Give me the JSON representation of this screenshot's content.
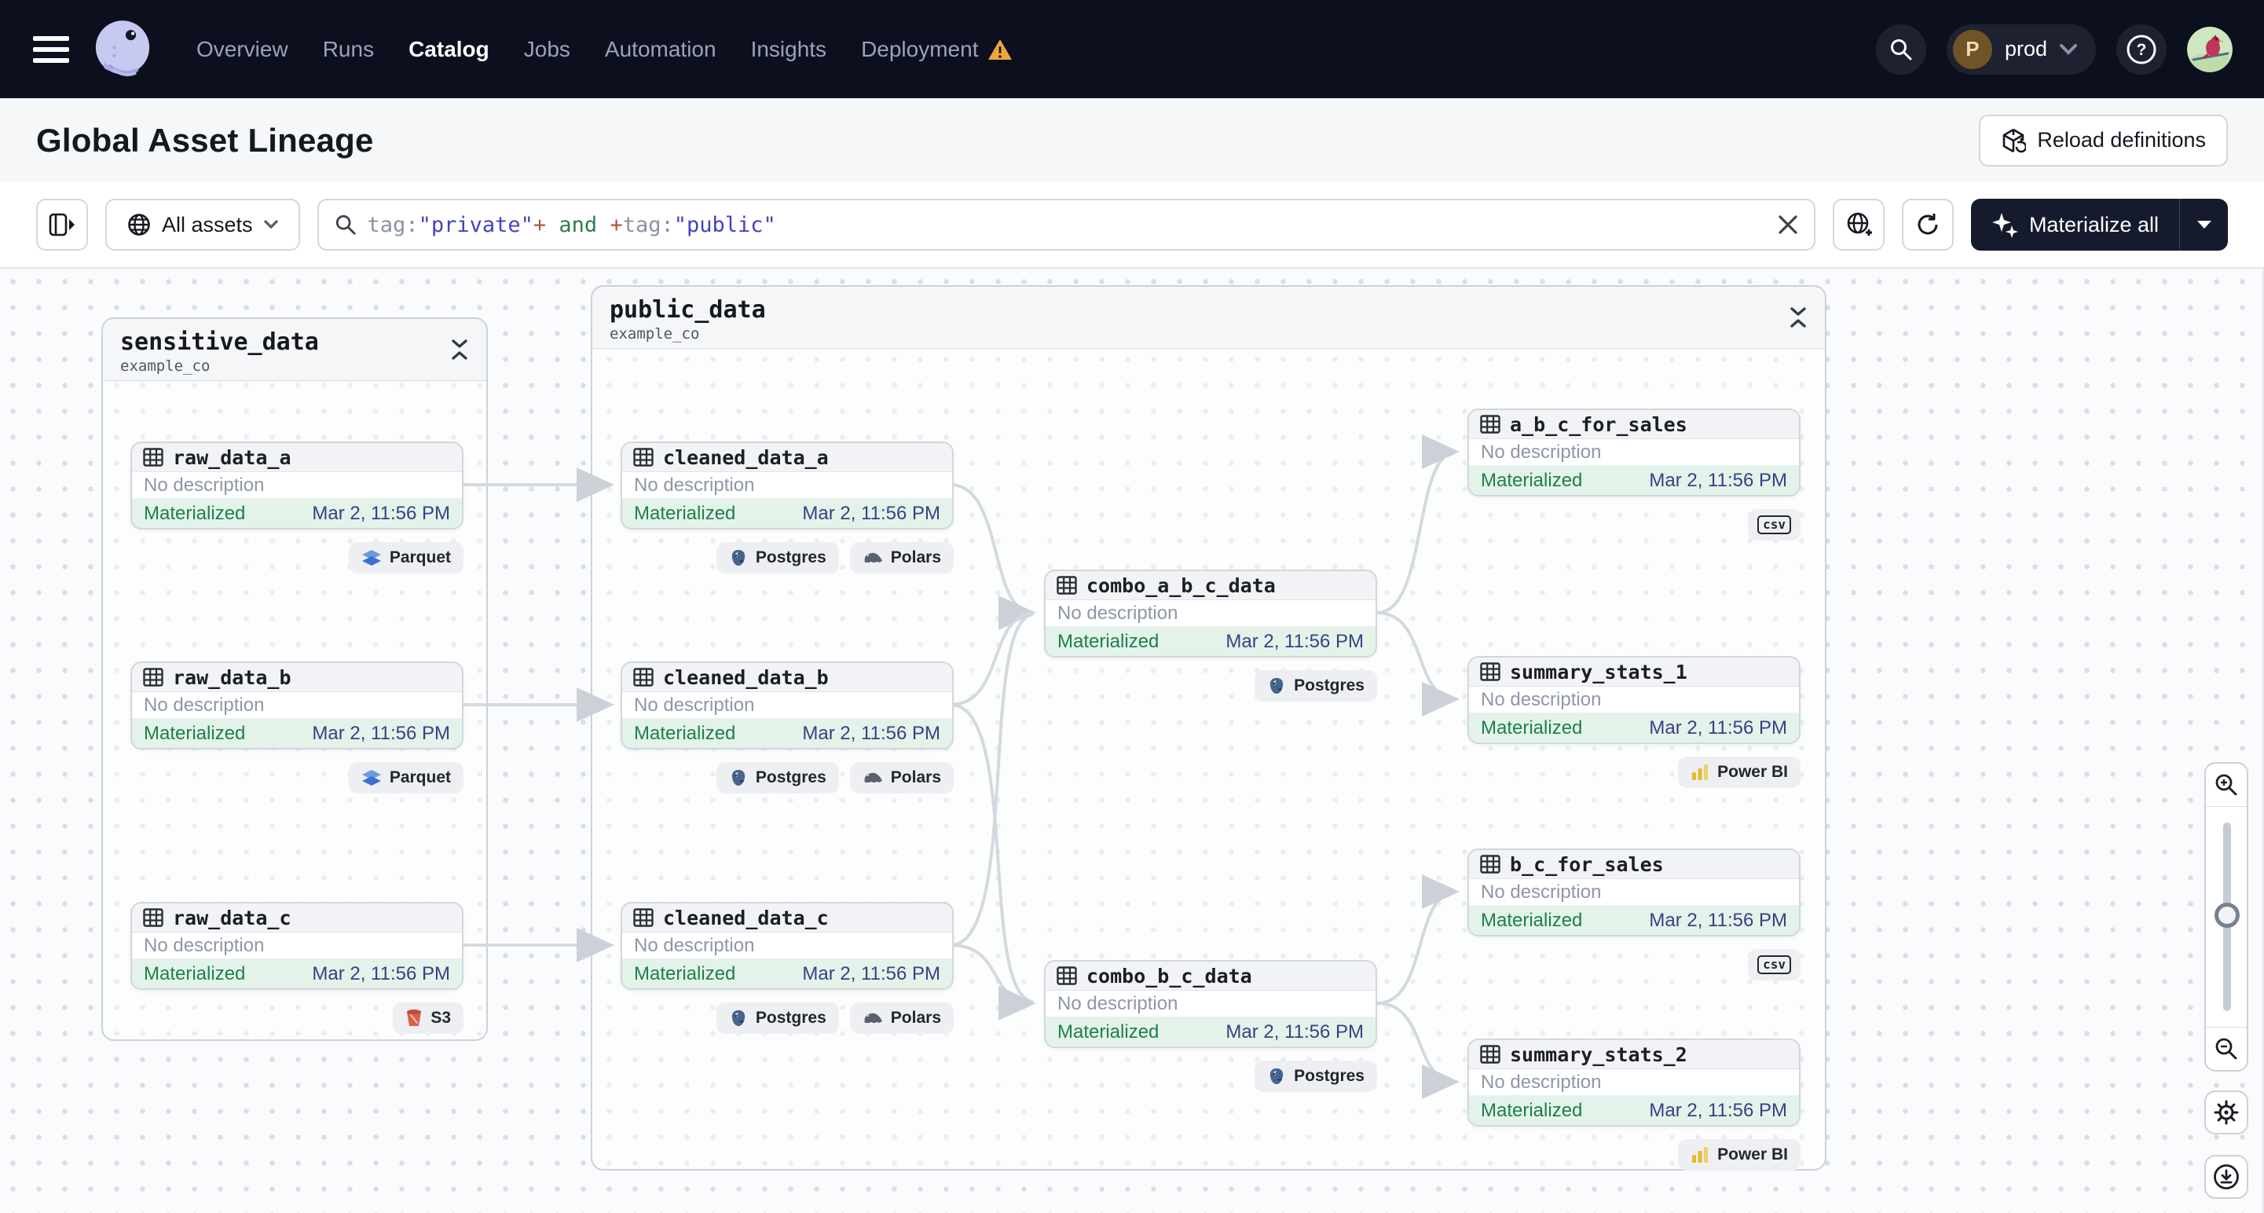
{
  "nav": {
    "items": [
      {
        "label": "Overview",
        "active": false
      },
      {
        "label": "Runs",
        "active": false
      },
      {
        "label": "Catalog",
        "active": true
      },
      {
        "label": "Jobs",
        "active": false
      },
      {
        "label": "Automation",
        "active": false
      },
      {
        "label": "Insights",
        "active": false
      },
      {
        "label": "Deployment",
        "active": false,
        "warning": true
      }
    ],
    "environment": {
      "initial": "P",
      "name": "prod"
    }
  },
  "header": {
    "title": "Global Asset Lineage",
    "reload_button": "Reload definitions"
  },
  "toolbar": {
    "scope_filter": "All assets",
    "query": {
      "segments": [
        {
          "text": "tag:",
          "role": "key"
        },
        {
          "text": "\"private\"",
          "role": "value"
        },
        {
          "text": "+",
          "role": "op"
        },
        {
          "text": " and ",
          "role": "kw"
        },
        {
          "text": "+",
          "role": "op"
        },
        {
          "text": "tag:",
          "role": "key"
        },
        {
          "text": "\"public\"",
          "role": "value"
        }
      ]
    },
    "materialize_button": "Materialize all"
  },
  "colors": {
    "nav_bg": "#0c0f1e",
    "accent_dark": "#151a2d",
    "materialized_green": "#1f7f4c",
    "materialized_bg": "#e3f3e9",
    "timestamp_blue": "#3a3f85",
    "warning_orange": "#eda63d",
    "edge_gray": "#d5d9df"
  },
  "graph": {
    "groups": [
      {
        "name": "sensitive_data",
        "repository": "example_co",
        "nodes": [
          {
            "id": "raw_data_a",
            "name": "raw_data_a",
            "description": "No description",
            "status": "Materialized",
            "status_time": "Mar 2, 11:56 PM",
            "tags": [
              {
                "label": "Parquet",
                "icon": "parquet-icon"
              }
            ]
          },
          {
            "id": "raw_data_b",
            "name": "raw_data_b",
            "description": "No description",
            "status": "Materialized",
            "status_time": "Mar 2, 11:56 PM",
            "tags": [
              {
                "label": "Parquet",
                "icon": "parquet-icon"
              }
            ]
          },
          {
            "id": "raw_data_c",
            "name": "raw_data_c",
            "description": "No description",
            "status": "Materialized",
            "status_time": "Mar 2, 11:56 PM",
            "tags": [
              {
                "label": "S3",
                "icon": "s3-bucket-icon"
              }
            ]
          }
        ]
      },
      {
        "name": "public_data",
        "repository": "example_co",
        "nodes": [
          {
            "id": "cleaned_data_a",
            "name": "cleaned_data_a",
            "description": "No description",
            "status": "Materialized",
            "status_time": "Mar 2, 11:56 PM",
            "tags": [
              {
                "label": "Postgres",
                "icon": "postgres-icon"
              },
              {
                "label": "Polars",
                "icon": "polars-icon"
              }
            ]
          },
          {
            "id": "cleaned_data_b",
            "name": "cleaned_data_b",
            "description": "No description",
            "status": "Materialized",
            "status_time": "Mar 2, 11:56 PM",
            "tags": [
              {
                "label": "Postgres",
                "icon": "postgres-icon"
              },
              {
                "label": "Polars",
                "icon": "polars-icon"
              }
            ]
          },
          {
            "id": "cleaned_data_c",
            "name": "cleaned_data_c",
            "description": "No description",
            "status": "Materialized",
            "status_time": "Mar 2, 11:56 PM",
            "tags": [
              {
                "label": "Postgres",
                "icon": "postgres-icon"
              },
              {
                "label": "Polars",
                "icon": "polars-icon"
              }
            ]
          },
          {
            "id": "combo_a_b_c_data",
            "name": "combo_a_b_c_data",
            "description": "No description",
            "status": "Materialized",
            "status_time": "Mar 2, 11:56 PM",
            "tags": [
              {
                "label": "Postgres",
                "icon": "postgres-icon"
              }
            ]
          },
          {
            "id": "combo_b_c_data",
            "name": "combo_b_c_data",
            "description": "No description",
            "status": "Materialized",
            "status_time": "Mar 2, 11:56 PM",
            "tags": [
              {
                "label": "Postgres",
                "icon": "postgres-icon"
              }
            ]
          },
          {
            "id": "a_b_c_for_sales",
            "name": "a_b_c_for_sales",
            "description": "No description",
            "status": "Materialized",
            "status_time": "Mar 2, 11:56 PM",
            "tags": [
              {
                "label": "csv",
                "icon": "csv-file-icon"
              }
            ]
          },
          {
            "id": "summary_stats_1",
            "name": "summary_stats_1",
            "description": "No description",
            "status": "Materialized",
            "status_time": "Mar 2, 11:56 PM",
            "tags": [
              {
                "label": "Power BI",
                "icon": "powerbi-icon"
              }
            ]
          },
          {
            "id": "b_c_for_sales",
            "name": "b_c_for_sales",
            "description": "No description",
            "status": "Materialized",
            "status_time": "Mar 2, 11:56 PM",
            "tags": [
              {
                "label": "csv",
                "icon": "csv-file-icon"
              }
            ]
          },
          {
            "id": "summary_stats_2",
            "name": "summary_stats_2",
            "description": "No description",
            "status": "Materialized",
            "status_time": "Mar 2, 11:56 PM",
            "tags": [
              {
                "label": "Power BI",
                "icon": "powerbi-icon"
              }
            ]
          }
        ]
      }
    ],
    "edges": [
      {
        "from": "raw_data_a",
        "to": "cleaned_data_a"
      },
      {
        "from": "raw_data_b",
        "to": "cleaned_data_b"
      },
      {
        "from": "raw_data_c",
        "to": "cleaned_data_c"
      },
      {
        "from": "cleaned_data_a",
        "to": "combo_a_b_c_data"
      },
      {
        "from": "cleaned_data_b",
        "to": "combo_a_b_c_data"
      },
      {
        "from": "cleaned_data_c",
        "to": "combo_a_b_c_data"
      },
      {
        "from": "cleaned_data_b",
        "to": "combo_b_c_data"
      },
      {
        "from": "cleaned_data_c",
        "to": "combo_b_c_data"
      },
      {
        "from": "combo_a_b_c_data",
        "to": "a_b_c_for_sales"
      },
      {
        "from": "combo_a_b_c_data",
        "to": "summary_stats_1"
      },
      {
        "from": "combo_b_c_data",
        "to": "b_c_for_sales"
      },
      {
        "from": "combo_b_c_data",
        "to": "summary_stats_2"
      }
    ]
  }
}
